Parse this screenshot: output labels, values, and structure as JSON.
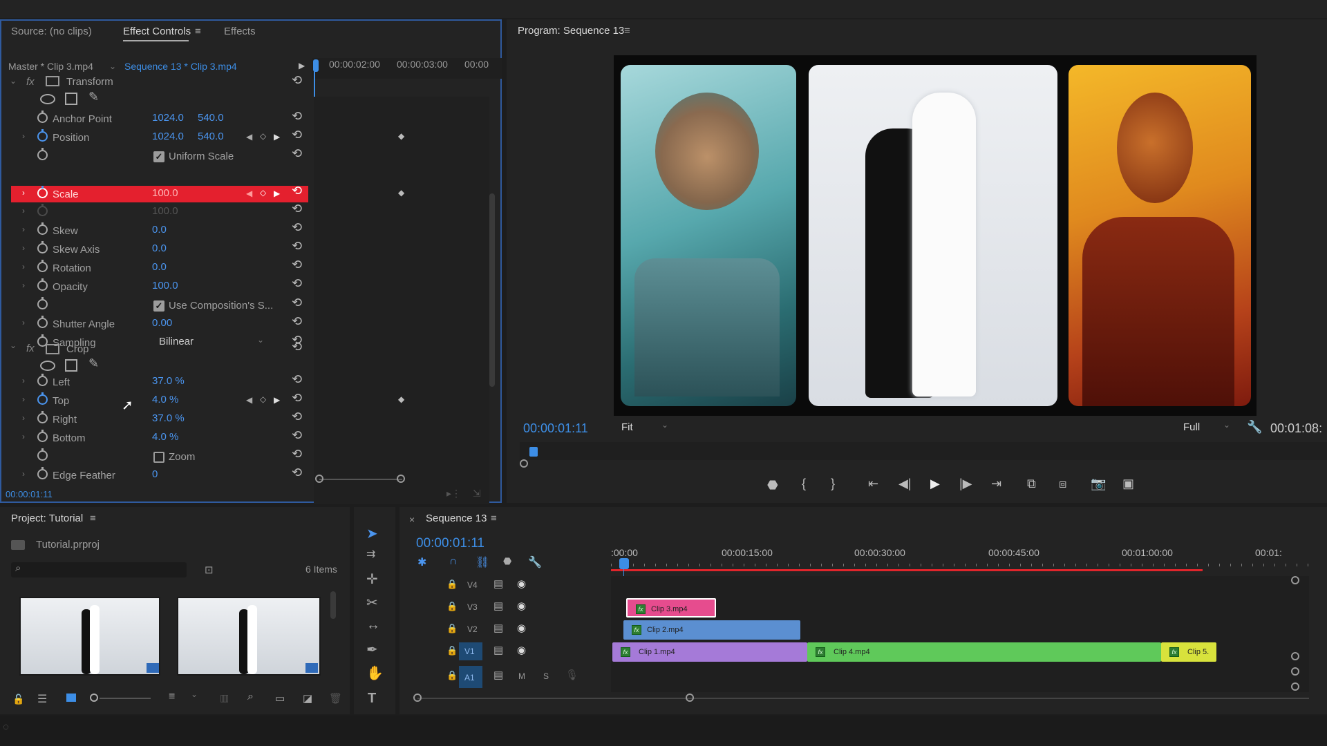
{
  "effect_controls": {
    "tabs": [
      "Source: (no clips)",
      "Effect Controls",
      "Effects"
    ],
    "master_label": "Master * Clip 3.mp4",
    "sequence_label": "Sequence 13 * Clip 3.mp4",
    "ruler": [
      "00:00:02:00",
      "00:00:03:00",
      "00:00"
    ],
    "transform_label": "Transform",
    "crop_label": "Crop",
    "rows": {
      "anchor": {
        "label": "Anchor Point",
        "v1": "1024.0",
        "v2": "540.0"
      },
      "position": {
        "label": "Position",
        "v1": "1024.0",
        "v2": "540.0"
      },
      "uniform": {
        "label": "Uniform Scale"
      },
      "scale": {
        "label": "Scale",
        "v1": "100.0"
      },
      "scale_w": {
        "v1": "100.0"
      },
      "skew": {
        "label": "Skew",
        "v1": "0.0"
      },
      "skew_axis": {
        "label": "Skew Axis",
        "v1": "0.0"
      },
      "rotation": {
        "label": "Rotation",
        "v1": "0.0"
      },
      "opacity": {
        "label": "Opacity",
        "v1": "100.0"
      },
      "use_comp": {
        "label": "Use Composition's S..."
      },
      "shutter": {
        "label": "Shutter Angle",
        "v1": "0.00"
      },
      "sampling": {
        "label": "Sampling",
        "v1": "Bilinear"
      },
      "left": {
        "label": "Left",
        "v1": "37.0 %"
      },
      "top": {
        "label": "Top",
        "v1": "4.0 %"
      },
      "right": {
        "label": "Right",
        "v1": "37.0 %"
      },
      "bottom": {
        "label": "Bottom",
        "v1": "4.0 %"
      },
      "zoom": {
        "label": "Zoom"
      },
      "edge": {
        "label": "Edge Feather",
        "v1": "0"
      }
    },
    "timecode": "00:00:01:11"
  },
  "program": {
    "title": "Program: Sequence 13",
    "timecode": "00:00:01:11",
    "fit": "Fit",
    "full": "Full",
    "duration": "00:01:08:"
  },
  "project": {
    "title": "Project: Tutorial",
    "file": "Tutorial.prproj",
    "items": "6 Items"
  },
  "timeline": {
    "title": "Sequence 13",
    "timecode": "00:00:01:11",
    "ruler": [
      ":00:00",
      "00:00:15:00",
      "00:00:30:00",
      "00:00:45:00",
      "00:01:00:00",
      "00:01:"
    ],
    "tracks": [
      "V4",
      "V3",
      "V2",
      "V1",
      "A1"
    ],
    "a1_m": "M",
    "a1_s": "S",
    "clips": {
      "c3": "Clip 3.mp4",
      "c2": "Clip 2.mp4",
      "c1": "Clip 1.mp4",
      "c4": "Clip 4.mp4",
      "c5": "Clip 5."
    }
  },
  "colors": {
    "accent": "#3d8ee6",
    "scale_highlight": "#e4202e",
    "clip3": "#e64c8e",
    "clip2": "#5b8fd1",
    "clip1": "#a57ad8",
    "clip4": "#5fc95a",
    "clip5": "#d8e23c"
  }
}
